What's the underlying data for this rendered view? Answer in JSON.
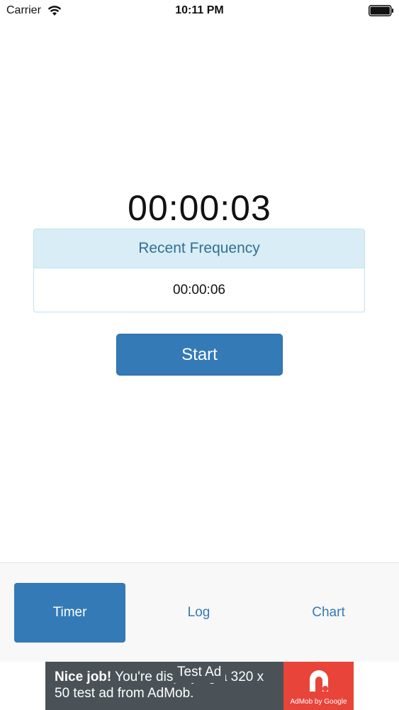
{
  "status_bar": {
    "carrier": "Carrier",
    "time": "10:11 PM"
  },
  "timer": {
    "elapsed": "00:00:03"
  },
  "recent_frequency": {
    "title": "Recent Frequency",
    "value": "00:00:06"
  },
  "start_button": {
    "label": "Start"
  },
  "tabs": [
    {
      "label": "Timer",
      "active": true
    },
    {
      "label": "Log",
      "active": false
    },
    {
      "label": "Chart",
      "active": false
    }
  ],
  "ad": {
    "label": "Test Ad",
    "headline": "Nice job!",
    "body": "You're displaying a 320 x 50 test ad from AdMob.",
    "brand": "AdMob by Google"
  },
  "colors": {
    "primary": "#337ab7",
    "panel_header_bg": "#d9edf7",
    "panel_header_text": "#31708f",
    "ad_bg": "#4a5257",
    "ad_logo_bg": "#e8443a"
  },
  "icons": {
    "wifi": "wifi-icon",
    "battery": "battery-icon",
    "admob": "admob-icon"
  }
}
